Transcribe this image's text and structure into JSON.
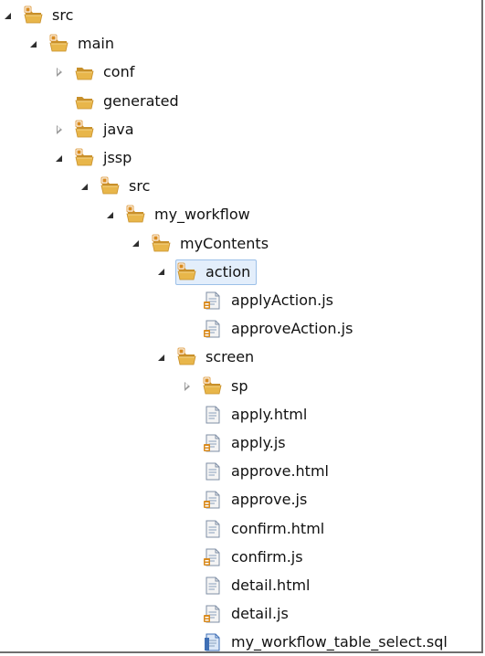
{
  "tree": {
    "items": [
      {
        "label": "src",
        "kind": "package-folder",
        "state": "expanded",
        "depth": 0
      },
      {
        "label": "main",
        "kind": "package-folder",
        "state": "expanded",
        "depth": 1
      },
      {
        "label": "conf",
        "kind": "folder",
        "state": "collapsed",
        "depth": 2
      },
      {
        "label": "generated",
        "kind": "folder",
        "state": "leaf",
        "depth": 2
      },
      {
        "label": "java",
        "kind": "package-folder",
        "state": "collapsed",
        "depth": 2
      },
      {
        "label": "jssp",
        "kind": "package-folder",
        "state": "expanded",
        "depth": 2
      },
      {
        "label": "src",
        "kind": "package-folder",
        "state": "expanded",
        "depth": 3
      },
      {
        "label": "my_workflow",
        "kind": "package-folder",
        "state": "expanded",
        "depth": 4
      },
      {
        "label": "myContents",
        "kind": "package-folder",
        "state": "expanded",
        "depth": 5
      },
      {
        "label": "action",
        "kind": "package-folder",
        "state": "expanded",
        "depth": 6,
        "selected": true
      },
      {
        "label": "applyAction.js",
        "kind": "js-file",
        "state": "leaf",
        "depth": 7
      },
      {
        "label": "approveAction.js",
        "kind": "js-file",
        "state": "leaf",
        "depth": 7
      },
      {
        "label": "screen",
        "kind": "package-folder",
        "state": "expanded",
        "depth": 6
      },
      {
        "label": "sp",
        "kind": "package-folder",
        "state": "collapsed",
        "depth": 7
      },
      {
        "label": "apply.html",
        "kind": "html-file",
        "state": "leaf",
        "depth": 7
      },
      {
        "label": "apply.js",
        "kind": "js-file",
        "state": "leaf",
        "depth": 7
      },
      {
        "label": "approve.html",
        "kind": "html-file",
        "state": "leaf",
        "depth": 7
      },
      {
        "label": "approve.js",
        "kind": "js-file",
        "state": "leaf",
        "depth": 7
      },
      {
        "label": "confirm.html",
        "kind": "html-file",
        "state": "leaf",
        "depth": 7
      },
      {
        "label": "confirm.js",
        "kind": "js-file",
        "state": "leaf",
        "depth": 7
      },
      {
        "label": "detail.html",
        "kind": "html-file",
        "state": "leaf",
        "depth": 7
      },
      {
        "label": "detail.js",
        "kind": "js-file",
        "state": "leaf",
        "depth": 7
      },
      {
        "label": "my_workflow_table_select.sql",
        "kind": "sql-file",
        "state": "leaf",
        "depth": 7
      }
    ]
  },
  "colors": {
    "folder": "#e8b64a",
    "folder_dark": "#c8902a",
    "package_badge": "#d98b1f",
    "selection_bg": "#e3eefb",
    "selection_border": "#9cc0e8",
    "file_blue": "#3f6fb5"
  }
}
